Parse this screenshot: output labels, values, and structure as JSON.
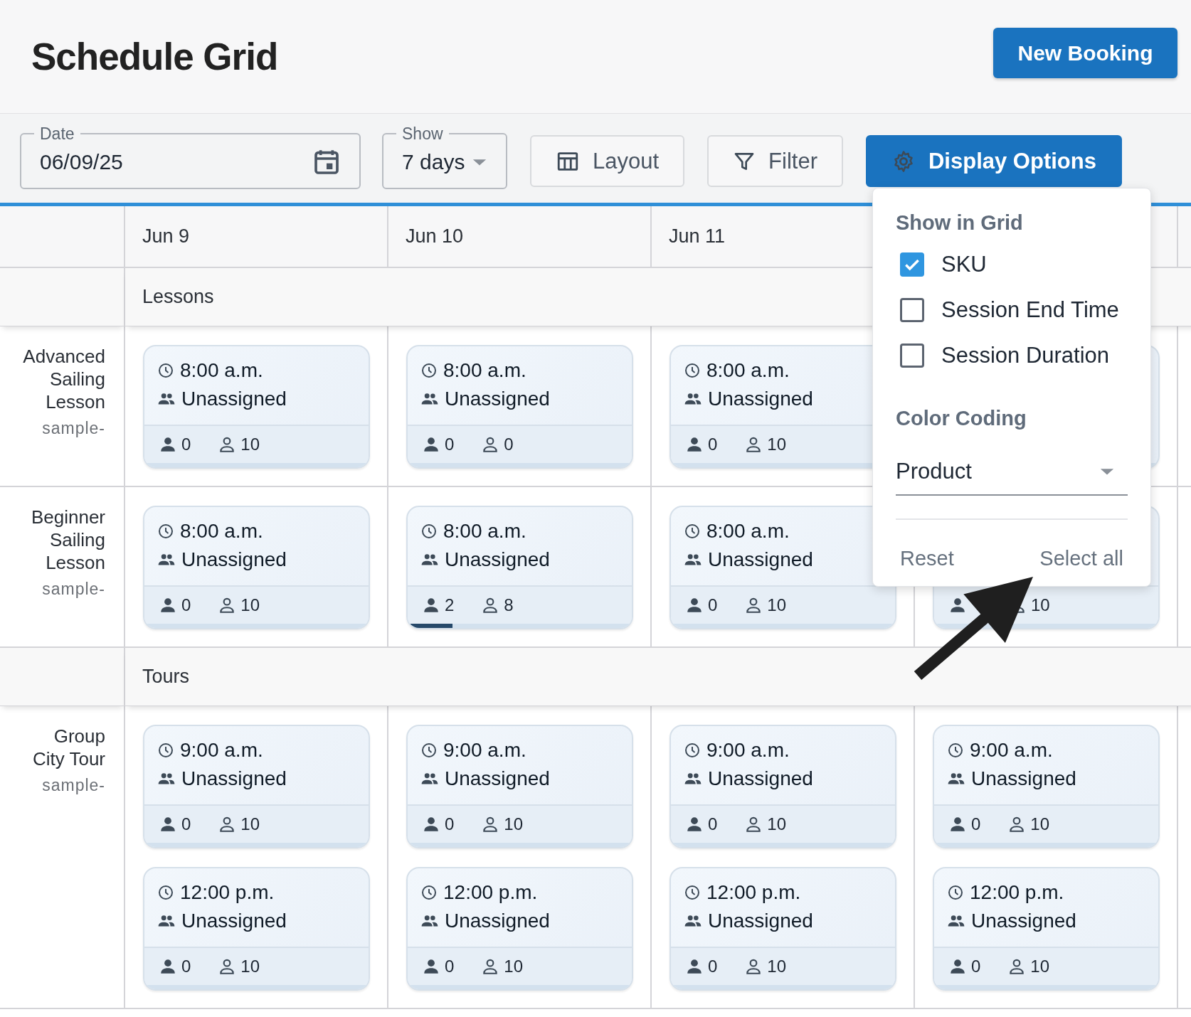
{
  "title": "Schedule Grid",
  "new_booking_button": "New Booking",
  "toolbar": {
    "date_field": {
      "label": "Date",
      "value": "06/09/25"
    },
    "show_field": {
      "label": "Show",
      "value": "7 days"
    },
    "buttons": [
      {
        "kind": "layout",
        "label": "Layout",
        "selected": false
      },
      {
        "kind": "filter",
        "label": "Filter",
        "selected": false
      },
      {
        "kind": "display",
        "label": "Display Options",
        "selected": true
      }
    ]
  },
  "columns": [
    "Jun 9",
    "Jun 10",
    "Jun 11"
  ],
  "groups": [
    {
      "name": "Lessons",
      "rows": [
        {
          "name": "Advanced Sailing Lesson",
          "sku": "sample-",
          "cells": [
            [
              {
                "time": "8:00 a.m.",
                "assignee": "Unassigned",
                "booked": "0",
                "capacity": "10"
              }
            ],
            [
              {
                "time": "8:00 a.m.",
                "assignee": "Unassigned",
                "booked": "0",
                "capacity": "0"
              }
            ],
            [
              {
                "time": "8:00 a.m.",
                "assignee": "Unassigned",
                "booked": "0",
                "capacity": "10"
              }
            ],
            [
              {}
            ]
          ]
        },
        {
          "name": "Beginner Sailing Lesson",
          "sku": "sample-",
          "cells": [
            [
              {
                "time": "8:00 a.m.",
                "assignee": "Unassigned",
                "booked": "0",
                "capacity": "10"
              }
            ],
            [
              {
                "time": "8:00 a.m.",
                "assignee": "Unassigned",
                "booked": "2",
                "capacity": "8",
                "level": 0.2
              }
            ],
            [
              {
                "time": "8:00 a.m.",
                "assignee": "Unassigned",
                "booked": "0",
                "capacity": "10"
              }
            ],
            [
              {
                "capacity": "10"
              }
            ]
          ]
        }
      ]
    },
    {
      "name": "Tours",
      "rows": [
        {
          "name": "Group City Tour",
          "sku": "sample-",
          "cells": [
            [
              {
                "time": "9:00 a.m.",
                "assignee": "Unassigned",
                "booked": "0",
                "capacity": "10"
              },
              {
                "time": "12:00 p.m.",
                "assignee": "Unassigned",
                "booked": "0",
                "capacity": "10"
              }
            ],
            [
              {
                "time": "9:00 a.m.",
                "assignee": "Unassigned",
                "booked": "0",
                "capacity": "10"
              },
              {
                "time": "12:00 p.m.",
                "assignee": "Unassigned",
                "booked": "0",
                "capacity": "10"
              }
            ],
            [
              {
                "time": "9:00 a.m.",
                "assignee": "Unassigned",
                "booked": "0",
                "capacity": "10"
              },
              {
                "time": "12:00 p.m.",
                "assignee": "Unassigned",
                "booked": "0",
                "capacity": "10"
              }
            ],
            [
              {
                "time": "9:00 a.m.",
                "assignee": "Unassigned",
                "booked": "0",
                "capacity": "10"
              },
              {
                "time": "12:00 p.m.",
                "assignee": "Unassigned",
                "booked": "0",
                "capacity": "10"
              }
            ]
          ]
        }
      ]
    }
  ],
  "display_options": {
    "show_in_grid_title": "Show in Grid",
    "checkboxes": [
      {
        "label": "SKU",
        "checked": true
      },
      {
        "label": "Session End Time",
        "checked": false
      },
      {
        "label": "Session Duration",
        "checked": false
      }
    ],
    "color_coding_title": "Color Coding",
    "color_coding_select": "Product",
    "actions": [
      "Reset",
      "Select all"
    ]
  }
}
